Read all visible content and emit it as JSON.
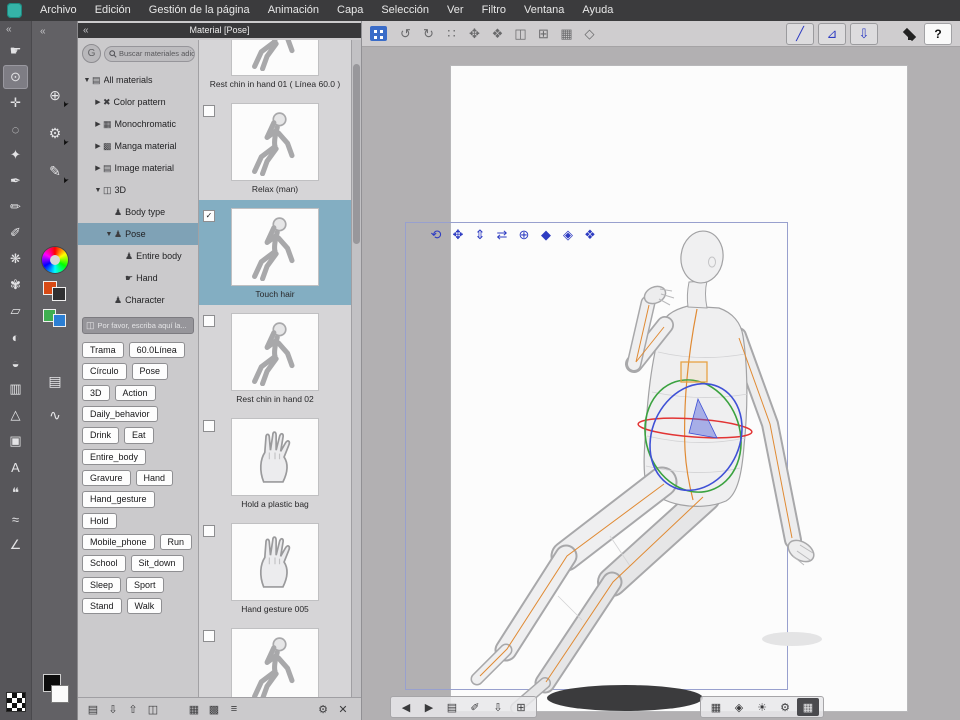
{
  "colors": {
    "accent_blue": "#2e3cc2",
    "selection_teal": "#83aec2",
    "tree_highlight": "#7fa2b6",
    "gizmo_red": "#e23434",
    "gizmo_green": "#3aa23f",
    "gizmo_blue": "#3f51d6",
    "joint_orange": "#e08a33"
  },
  "menubar": {
    "items": [
      "Archivo",
      "Edición",
      "Gestión de la página",
      "Animación",
      "Capa",
      "Selección",
      "Ver",
      "Filtro",
      "Ventana",
      "Ayuda"
    ]
  },
  "command_bar": {
    "left_icons": [
      {
        "name": "undo-icon",
        "glyph": "↺"
      },
      {
        "name": "redo-icon",
        "glyph": "↻"
      },
      {
        "name": "deselect-icon",
        "glyph": "∷"
      },
      {
        "name": "move-canvas-icon",
        "glyph": "✥"
      },
      {
        "name": "rotate-canvas-icon",
        "glyph": "❖"
      },
      {
        "name": "flip-horizontal-icon",
        "glyph": "◫"
      },
      {
        "name": "grid-icon",
        "glyph": "⊞"
      },
      {
        "name": "snap-ruler-icon",
        "glyph": "▦"
      },
      {
        "name": "special-ruler-icon",
        "glyph": "◇"
      }
    ],
    "right_icons": {
      "perspective_ruler_glyph": "╱",
      "symmetry_ruler_glyph": "⊿",
      "import_3d_glyph": "⇩",
      "help_label": "?"
    }
  },
  "tool_strip_primary": [
    {
      "name": "hand-tool",
      "glyph": "☛"
    },
    {
      "name": "operation-tool",
      "glyph": "⊙",
      "selected": true
    },
    {
      "name": "move-layer-tool",
      "glyph": "✛"
    },
    {
      "name": "selection-tool",
      "glyph": "◌"
    },
    {
      "name": "magic-wand-tool",
      "glyph": "✦"
    },
    {
      "name": "pen-tool",
      "glyph": "✒"
    },
    {
      "name": "pencil-tool",
      "glyph": "✏"
    },
    {
      "name": "brush-tool",
      "glyph": "✐"
    },
    {
      "name": "airbrush-tool",
      "glyph": "❋"
    },
    {
      "name": "decoration-tool",
      "glyph": "✾"
    },
    {
      "name": "eraser-tool",
      "glyph": "▱"
    },
    {
      "name": "blend-tool",
      "glyph": "◐"
    },
    {
      "name": "fill-tool",
      "glyph": "◒"
    },
    {
      "name": "gradient-tool",
      "glyph": "▥"
    },
    {
      "name": "figure-tool",
      "glyph": "△"
    },
    {
      "name": "frame-border-tool",
      "glyph": "▣"
    },
    {
      "name": "text-tool",
      "glyph": "A"
    },
    {
      "name": "balloon-tool",
      "glyph": "❝"
    },
    {
      "name": "correction-line-tool",
      "glyph": "≈"
    },
    {
      "name": "ruler-tool",
      "glyph": "∠"
    }
  ],
  "tool_strip_secondary": {
    "cursor_tools": [
      {
        "name": "magnifier-cursor-tool",
        "glyph": "⊕"
      },
      {
        "name": "gear-cursor-tool",
        "glyph": "⚙"
      },
      {
        "name": "pen-cursor-tool",
        "glyph": "✎"
      }
    ],
    "misc_tools": [
      {
        "name": "paper-tool",
        "glyph": "▤"
      },
      {
        "name": "spring-tool",
        "glyph": "∿"
      }
    ]
  },
  "material_panel": {
    "title": "Material [Pose]",
    "search_placeholder": "Buscar materiales adic...",
    "tree": [
      {
        "level": 0,
        "arrow": "▼",
        "icon": "▤",
        "label": "All materials"
      },
      {
        "level": 1,
        "arrow": "▶",
        "icon": "✖",
        "label": "Color pattern"
      },
      {
        "level": 1,
        "arrow": "▶",
        "icon": "▦",
        "label": "Monochromatic"
      },
      {
        "level": 1,
        "arrow": "▶",
        "icon": "▩",
        "label": "Manga material"
      },
      {
        "level": 1,
        "arrow": "▶",
        "icon": "▤",
        "label": "Image material"
      },
      {
        "level": 1,
        "arrow": "▼",
        "icon": "◫",
        "label": "3D"
      },
      {
        "level": 2,
        "arrow": "",
        "icon": "♟",
        "label": "Body type"
      },
      {
        "level": 2,
        "arrow": "▼",
        "icon": "♟",
        "label": "Pose",
        "selected": true
      },
      {
        "level": 3,
        "arrow": "",
        "icon": "♟",
        "label": "Entire body"
      },
      {
        "level": 3,
        "arrow": "",
        "icon": "☛",
        "label": "Hand"
      },
      {
        "level": 2,
        "arrow": "",
        "icon": "♟",
        "label": "Character"
      }
    ],
    "tag_search_placeholder": "Por favor, escriba aquí la...",
    "tags": [
      "Trama",
      "60.0Línea",
      "Círculo",
      "Pose",
      "3D",
      "Action",
      "Daily_behavior",
      "Drink",
      "Eat",
      "Entire_body",
      "Gravure",
      "Hand",
      "Hand_gesture",
      "Hold",
      "Mobile_phone",
      "Run",
      "School",
      "Sit_down",
      "Sleep",
      "Sport",
      "Stand",
      "Walk"
    ],
    "footer_left": [
      {
        "name": "folder-icon",
        "glyph": "▤"
      },
      {
        "name": "import-material-icon",
        "glyph": "⇩"
      },
      {
        "name": "export-material-icon",
        "glyph": "⇧"
      },
      {
        "name": "new-folder-icon",
        "glyph": "◫"
      }
    ],
    "footer_mid": [
      {
        "name": "thumbnail-large-icon",
        "glyph": "▦"
      },
      {
        "name": "thumbnail-small-icon",
        "glyph": "▩"
      },
      {
        "name": "list-view-icon",
        "glyph": "≡"
      }
    ],
    "footer_right": [
      {
        "name": "settings-icon",
        "glyph": "⚙"
      },
      {
        "name": "delete-material-icon",
        "glyph": "✕"
      }
    ]
  },
  "material_list": {
    "items": [
      {
        "label": "Rest chin in hand 01 ( Línea 60.0 )",
        "check": "",
        "icon_ref": "#thumb-pose",
        "clipped_top": true
      },
      {
        "label": "Relax (man)",
        "check": "",
        "icon_ref": "#thumb-pose"
      },
      {
        "label": "Touch hair",
        "check": "✓",
        "icon_ref": "#thumb-pose",
        "selected": true
      },
      {
        "label": "Rest chin in hand 02",
        "check": "",
        "icon_ref": "#thumb-pose"
      },
      {
        "label": "Hold a plastic bag",
        "check": "",
        "icon_ref": "#thumb-hand"
      },
      {
        "label": "Hand gesture 005",
        "check": "",
        "icon_ref": "#thumb-hand"
      },
      {
        "label": "",
        "check": "",
        "icon_ref": "#thumb-pose"
      }
    ]
  },
  "toolbar3d": [
    {
      "name": "camera-rotate-icon",
      "glyph": "⟲"
    },
    {
      "name": "camera-pan-icon",
      "glyph": "✥"
    },
    {
      "name": "camera-zoom-icon",
      "glyph": "⇕"
    },
    {
      "name": "object-move-icon",
      "glyph": "⇄"
    },
    {
      "name": "object-rotate-icon",
      "glyph": "⊕"
    },
    {
      "name": "object-pan-icon",
      "glyph": "◆"
    },
    {
      "name": "model-pose-icon",
      "glyph": "◈"
    },
    {
      "name": "model-settings-icon",
      "glyph": "❖"
    }
  ],
  "launcher": {
    "left_icons": [
      {
        "name": "previous-pose-icon",
        "glyph": "◀"
      },
      {
        "name": "next-pose-icon",
        "glyph": "▶"
      },
      {
        "name": "pose-list-icon",
        "glyph": "▤"
      },
      {
        "name": "register-material-icon",
        "glyph": "✐"
      },
      {
        "name": "import-pose-icon",
        "glyph": "⇩"
      },
      {
        "name": "ground-settings-icon",
        "glyph": "⊞"
      }
    ],
    "right_icons": [
      {
        "name": "mesh-display-icon",
        "glyph": "▦"
      },
      {
        "name": "model-structure-icon",
        "glyph": "◈"
      },
      {
        "name": "light-source-icon",
        "glyph": "☀"
      },
      {
        "name": "object-config-icon",
        "glyph": "⚙"
      },
      {
        "name": "drag-model-icon",
        "glyph": "▦",
        "dark": true
      }
    ]
  }
}
